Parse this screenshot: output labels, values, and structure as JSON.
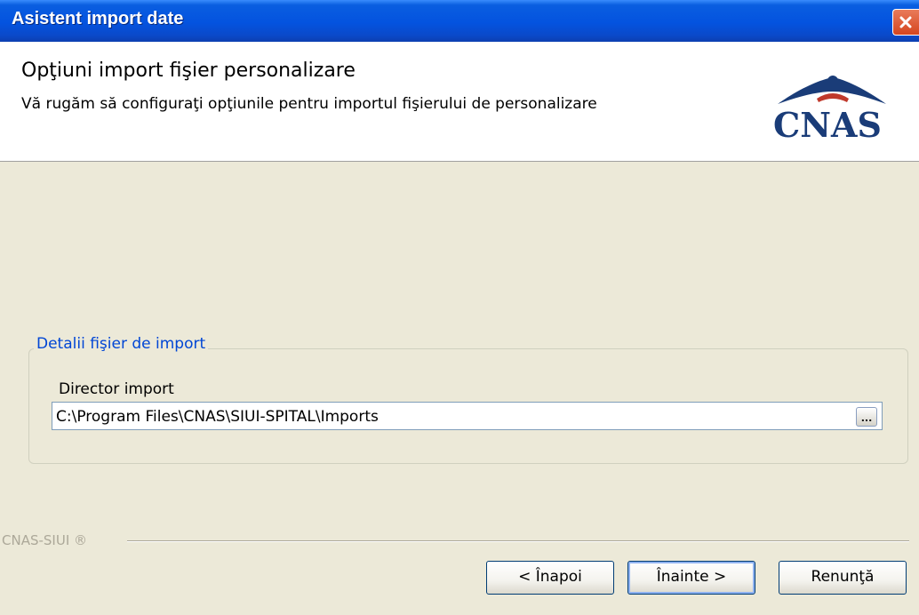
{
  "window": {
    "title": "Asistent import date",
    "close_icon": "close-icon"
  },
  "header": {
    "title": "Opţiuni import fişier personalizare",
    "subtitle": "Vă rugăm să configuraţi opţiunile pentru importul fişierului de personalizare",
    "logo_text": "CNAS"
  },
  "details": {
    "group_title": "Detalii fişier de import",
    "field_label": "Director import",
    "field_value": "C:\\Program Files\\CNAS\\SIUI-SPITAL\\Imports",
    "browse_label": "..."
  },
  "footer": {
    "brand": "CNAS-SIUI ®",
    "back_label": "< Înapoi",
    "next_label": "Înainte >",
    "cancel_label": "Renunţă"
  },
  "colors": {
    "titlebar": "#0453df",
    "group_title": "#0046d5",
    "logo": "#1a3c78"
  }
}
